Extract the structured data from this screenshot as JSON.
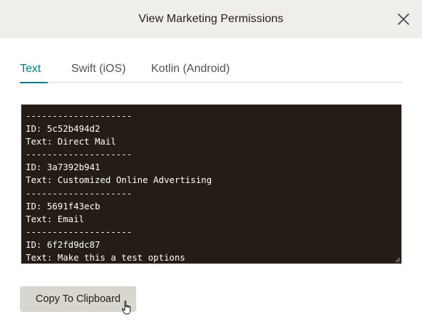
{
  "modal": {
    "title": "View Marketing Permissions"
  },
  "tabs": [
    {
      "label": "Text",
      "active": true
    },
    {
      "label": "Swift (iOS)",
      "active": false
    },
    {
      "label": "Kotlin (Android)",
      "active": false
    }
  ],
  "code": {
    "lines": [
      "--------------------",
      "ID: 5c52b494d2",
      "Text: Direct Mail",
      "--------------------",
      "ID: 3a7392b941",
      "Text: Customized Online Advertising",
      "--------------------",
      "ID: 5691f43ecb",
      "Text: Email",
      "--------------------",
      "ID: 6f2fd9dc87",
      "Text: Make this a test options"
    ]
  },
  "actions": {
    "copy_label": "Copy To Clipboard"
  },
  "colors": {
    "accent": "#007c89",
    "header_bg": "#efeeea",
    "code_bg": "#241c15",
    "button_bg": "#d9d6cf"
  },
  "icons": {
    "close": "close-icon",
    "cursor": "hand-pointer-icon"
  }
}
